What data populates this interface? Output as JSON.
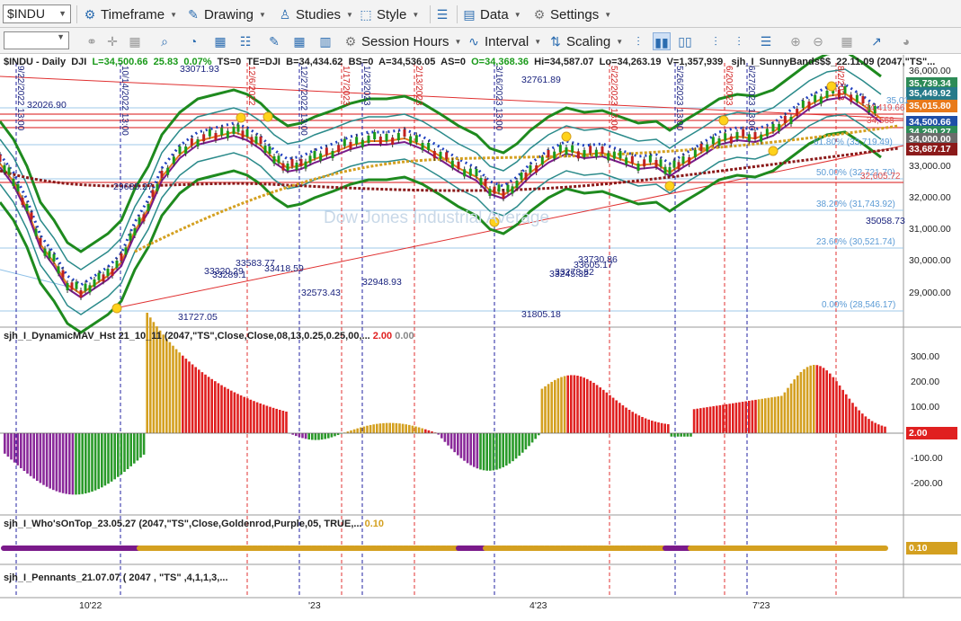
{
  "toolbar1": {
    "symbol": "$INDU",
    "timeframe": "Timeframe",
    "drawing": "Drawing",
    "studies": "Studies",
    "style": "Style",
    "data": "Data",
    "settings": "Settings"
  },
  "toolbar2": {
    "interval_value": "",
    "session_hours": "Session Hours",
    "interval": "Interval",
    "scaling": "Scaling"
  },
  "chart_header": {
    "symbol": "$INDU - Daily",
    "exchange": "DJI",
    "last": "L=34,500.66",
    "change": "25.83",
    "change_pct": "0.07%",
    "ts": "TS=0",
    "te": "TE=DJI",
    "b": "B=34,434.62",
    "bs": "BS=0",
    "a": "A=34,536.05",
    "as": "AS=0",
    "open": "O=34,368.36",
    "high": "Hi=34,587.07",
    "low": "Lo=34,263.19",
    "volume": "V=1,357,939",
    "study": "sjh_I_SunnyBands$$_22.11.09 (2047,\"TS\"..."
  },
  "watermark": "Dow Jones Industrial Average",
  "price_axis": [
    "36,000.00",
    "35,000.00",
    "34,000.00",
    "33,000.00",
    "32,000.00",
    "31,000.00",
    "30,000.00",
    "29,000.00"
  ],
  "price_tags": [
    {
      "label": "35,739.34",
      "color": "#2e8b57"
    },
    {
      "label": "35,449.92",
      "color": "#267a8a"
    },
    {
      "label": "35,015.80",
      "color": "#e8791a"
    },
    {
      "label": "34,500.66",
      "color": "#1f4fa8"
    },
    {
      "label": "34,290.27",
      "color": "#2e8b57"
    },
    {
      "label": "34,000.00",
      "color": "#6b6b6b"
    },
    {
      "label": "33,687.17",
      "color": "#8b1a1a"
    }
  ],
  "fib_labels": [
    "61.80% (33,719.49)",
    "50.00% (32,721.70)",
    "38.20% (31,743.92)",
    "23.60% (30,521.74)",
    "0.00% (28,546.17)"
  ],
  "fib_tops": [
    "34,419.66",
    "32,605.72",
    "34,568",
    "35,01"
  ],
  "price_annotations": [
    "33071.93",
    "32026.90",
    "29685.27",
    "33583.77",
    "33320.29",
    "33418.59",
    "33289.1",
    "32573.43",
    "32948.93",
    "31727.05",
    "32761.89",
    "33730.86",
    "33605.17",
    "33245.32",
    "33278.82",
    "31805.18",
    "35058.73"
  ],
  "date_marks": [
    "9/22/2022 13:00",
    "10/14/2022 13:00",
    "12/6/2022",
    "12/27/2022 13:00",
    "1/17/2023",
    "1/23/2023",
    "2/13/2023",
    "3/16/2023 13:00",
    "5/22/2023 13:00",
    "5/26/2023 13:00",
    "6/20/2023",
    "6/27/2023 13:00",
    "8/2/2023"
  ],
  "panel2": {
    "title": "sjh_I_DynamicMAV_Hst 21_10_11 (2047,\"TS\",Close,Close,08,13,0.25,0.25,00,...",
    "v1": "2.00",
    "v2": "0.00",
    "axis": [
      "300.00",
      "200.00",
      "100.00",
      "-100.00",
      "-200.00"
    ],
    "tag": "2.00"
  },
  "panel3": {
    "title": "sjh_I_Who'sOnTop_23.05.27 (2047,\"TS\",Close,Goldenrod,Purple,05,  TRUE,...",
    "v1": "0.10",
    "tag": "0.10"
  },
  "panel4": {
    "title": "sjh_I_Pennants_21.07.07 ( 2047 , \"TS\" ,4,1,1,3,..."
  },
  "time_axis": [
    "10'22",
    "'23",
    "4'23",
    "7'23"
  ],
  "colors": {
    "green_band": "#1e8a1e",
    "teal_band": "#2a8a8a",
    "red_line": "#e03030",
    "gold": "#d4a020",
    "purple": "#7a1a8a",
    "hist_red": "#e02020",
    "hist_gold": "#d4a020",
    "hist_green": "#2a9a2a",
    "hist_purple": "#8a2a9a"
  }
}
